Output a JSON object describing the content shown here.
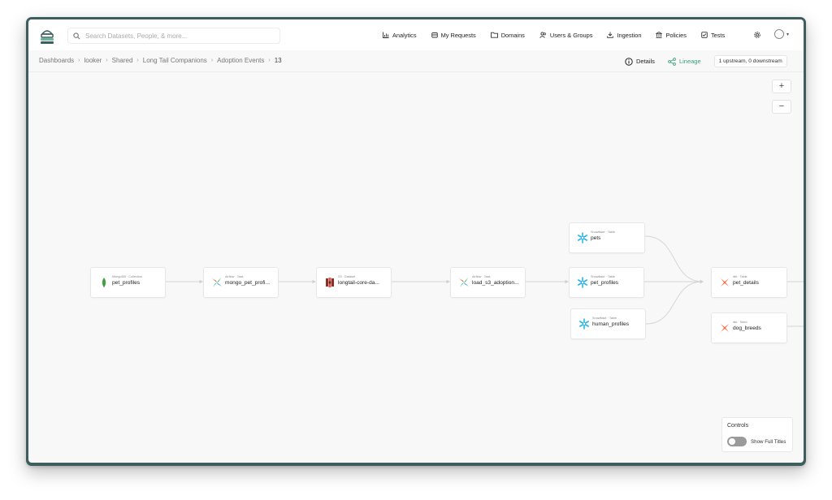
{
  "search": {
    "placeholder": "Search Datasets, People, & more..."
  },
  "nav": {
    "items": [
      {
        "label": "Analytics",
        "icon": "analytics-icon"
      },
      {
        "label": "My Requests",
        "icon": "requests-icon"
      },
      {
        "label": "Domains",
        "icon": "folder-icon"
      },
      {
        "label": "Users & Groups",
        "icon": "users-icon"
      },
      {
        "label": "Ingestion",
        "icon": "ingestion-icon"
      },
      {
        "label": "Policies",
        "icon": "bank-icon"
      },
      {
        "label": "Tests",
        "icon": "tests-icon"
      }
    ]
  },
  "breadcrumb": [
    "Dashboards",
    "looker",
    "Shared",
    "Long Tail Companions",
    "Adoption Events",
    "13"
  ],
  "view": {
    "details_label": "Details",
    "lineage_label": "Lineage",
    "upstream_summary": "1 upstream, 0 downstream"
  },
  "zoom": {
    "in_label": "+",
    "out_label": "−"
  },
  "lineage": {
    "nodes": [
      {
        "id": "n1",
        "name": "pet_profiles",
        "type": "MongoDB · Collection",
        "platform": "mongodb"
      },
      {
        "id": "n2",
        "name": "mongo_pet_profi...",
        "type": "Airflow · Task",
        "platform": "airflow"
      },
      {
        "id": "n3",
        "name": "longtail-core-da...",
        "type": "S3 · Dataset",
        "platform": "s3"
      },
      {
        "id": "n4",
        "name": "load_s3_adoption...",
        "type": "Airflow · Task",
        "platform": "airflow"
      },
      {
        "id": "n5",
        "name": "pets",
        "type": "Snowflake · Table",
        "platform": "snowflake"
      },
      {
        "id": "n6",
        "name": "pet_profiles",
        "type": "Snowflake · Table",
        "platform": "snowflake"
      },
      {
        "id": "n7",
        "name": "human_profiles",
        "type": "Snowflake · Table",
        "platform": "snowflake"
      },
      {
        "id": "n8",
        "name": "pet_details",
        "type": "dbt · Table",
        "platform": "dbt"
      },
      {
        "id": "n9",
        "name": "dog_breeds",
        "type": "dbt · Seed",
        "platform": "dbt"
      }
    ]
  },
  "controls": {
    "title": "Controls",
    "toggle_label": "Show Full Titles",
    "show_full_titles": false
  },
  "colors": {
    "brand": "#3d5e5c",
    "accent": "#3b9e7d",
    "snowflake": "#29b5e8",
    "dbt": "#ff694b",
    "s3": "#c7392b",
    "mongodb": "#4ea94b"
  }
}
